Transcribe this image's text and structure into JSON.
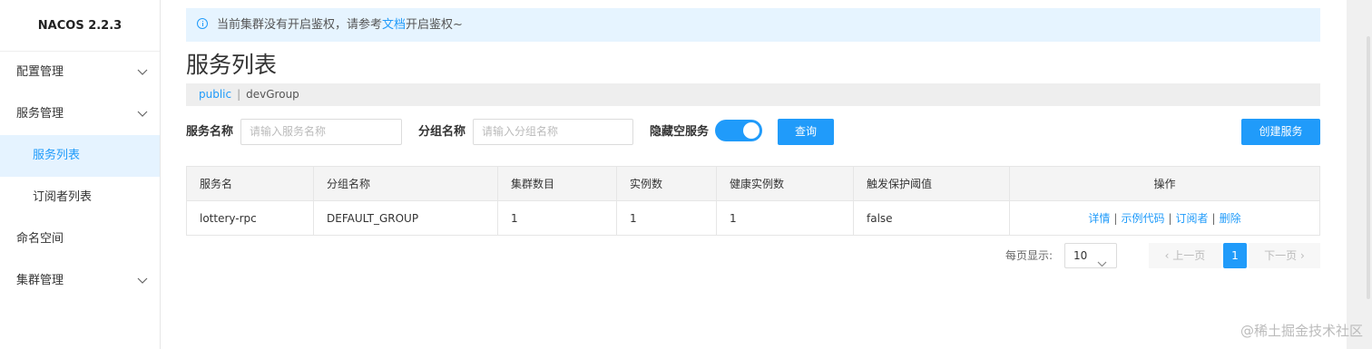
{
  "brand": "NACOS 2.2.3",
  "sidebar": {
    "items": [
      {
        "label": "配置管理"
      },
      {
        "label": "服务管理"
      },
      {
        "label": "服务列表"
      },
      {
        "label": "订阅者列表"
      },
      {
        "label": "命名空间"
      },
      {
        "label": "集群管理"
      }
    ]
  },
  "notice": {
    "before": "当前集群没有开启鉴权，请参考",
    "link": "文档",
    "after": "开启鉴权~"
  },
  "page_title": "服务列表",
  "namespace": {
    "current": "public",
    "group": "devGroup"
  },
  "filters": {
    "service_label": "服务名称",
    "service_placeholder": "请输入服务名称",
    "group_label": "分组名称",
    "group_placeholder": "请输入分组名称",
    "hide_empty_label": "隐藏空服务",
    "query_button": "查询",
    "create_button": "创建服务"
  },
  "table": {
    "headers": [
      "服务名",
      "分组名称",
      "集群数目",
      "实例数",
      "健康实例数",
      "触发保护阈值",
      "操作"
    ],
    "rows": [
      {
        "name": "lottery-rpc",
        "group": "DEFAULT_GROUP",
        "clusters": "1",
        "instances": "1",
        "healthy": "1",
        "threshold": "false"
      }
    ],
    "ops": [
      "详情",
      "示例代码",
      "订阅者",
      "删除"
    ],
    "ops_sep": "|"
  },
  "pagination": {
    "per_page_label": "每页显示:",
    "page_size": "10",
    "prev": "上一页",
    "current": "1",
    "next": "下一页"
  },
  "watermark": "@稀土掘金技术社区",
  "colors": {
    "accent": "#209bfa"
  }
}
